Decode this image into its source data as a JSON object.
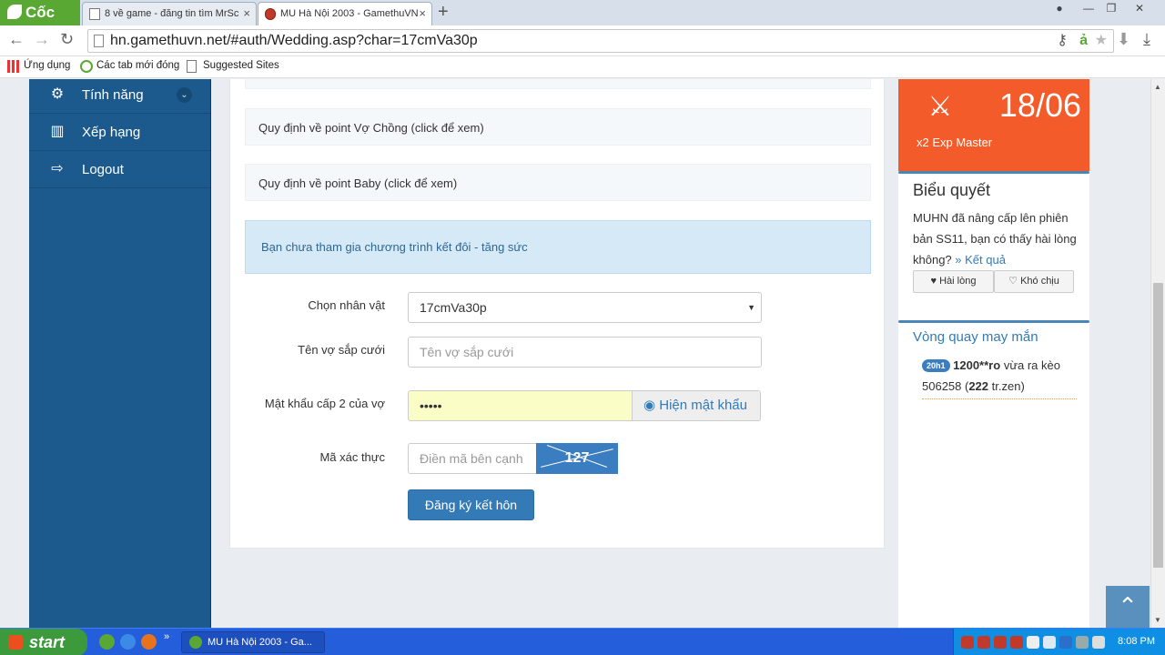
{
  "browser": {
    "brand": "Cốc Cốc",
    "tabs": [
      {
        "title": "8 về game - đăng tin tìm MrSc"
      },
      {
        "title": "MU Hà Nội 2003 - GamethuVN"
      }
    ],
    "url": "hn.gamethuvn.net/#auth/Wedding.asp?char=17cmVa30p",
    "bookmarks": [
      "Ứng dụng",
      "Các tab mới đóng",
      "Suggested Sites"
    ]
  },
  "sidebar": {
    "items": [
      {
        "label": "Tính năng",
        "icon": "gears-icon"
      },
      {
        "label": "Xếp hạng",
        "icon": "bar-chart-icon"
      },
      {
        "label": "Logout",
        "icon": "sign-out-icon"
      }
    ]
  },
  "main": {
    "rules": [
      "Quy định về point Vợ Chồng (click để xem)",
      "Quy định về point Baby (click để xem)"
    ],
    "alert": "Bạn chưa tham gia chương trình kết đôi - tăng sức",
    "form": {
      "character_label": "Chọn nhân vật",
      "character_value": "17cmVa30p",
      "spouse_label": "Tên vợ sắp cưới",
      "spouse_placeholder": "Tên vợ sắp cưới",
      "password_label": "Mật khẩu cấp 2 của vợ",
      "password_value": "•••••",
      "show_password": "Hiện mật khẩu",
      "captcha_label": "Mã xác thực",
      "captcha_placeholder": "Điền mã bên cạnh",
      "captcha_text": "127",
      "submit": "Đăng ký kết hôn"
    }
  },
  "right": {
    "promo": {
      "date": "18/06",
      "subtitle": "x2 Exp Master"
    },
    "poll": {
      "title": "Biểu quyết",
      "question": "MUHN đã nâng cấp lên phiên bản SS11, bạn có thấy hài lòng không?",
      "result_link": "» Kết quả",
      "like": "Hài lòng",
      "dislike": "Khó chịu"
    },
    "lucky": {
      "title": "Vòng quay may mắn",
      "badge": "20h1",
      "user": "1200**ro",
      "text1": "vừa ra kèo 506258 (",
      "amount": "222",
      "text2": "tr.zen)"
    }
  },
  "taskbar": {
    "start": "start",
    "task": "MU Hà Nội 2003 - Ga...",
    "clock": "8:08 PM"
  }
}
